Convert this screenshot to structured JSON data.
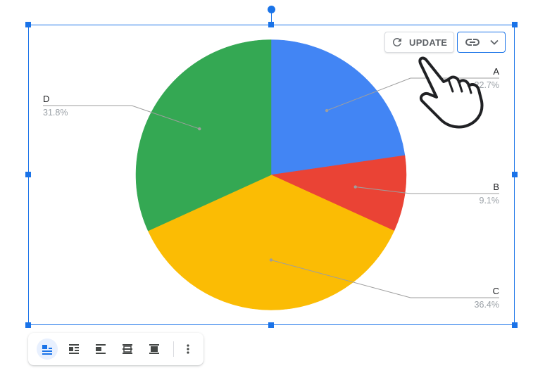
{
  "chart_data": {
    "type": "pie",
    "slices": [
      {
        "label": "A",
        "value": 22.7,
        "display": "22.7%",
        "color": "#4285f4"
      },
      {
        "label": "B",
        "value": 9.1,
        "display": "9.1%",
        "color": "#ea4335"
      },
      {
        "label": "C",
        "value": 36.4,
        "display": "36.4%",
        "color": "#fbbc04"
      },
      {
        "label": "D",
        "value": 31.8,
        "display": "31.8%",
        "color": "#34a853"
      }
    ],
    "start_angle_degrees": 0,
    "direction": "clockwise",
    "legend": "labeled leader lines"
  },
  "controls": {
    "update_label": "UPDATE",
    "update_icon": "refresh-icon",
    "link_icon": "link-icon",
    "link_dropdown_icon": "chevron-down-icon"
  },
  "toolbar": {
    "items": [
      {
        "name": "inline-text-button",
        "icon": "wrap-inline-icon",
        "active": true
      },
      {
        "name": "wrap-text-button",
        "icon": "wrap-text-icon",
        "active": false
      },
      {
        "name": "break-text-button",
        "icon": "break-text-icon",
        "active": false
      },
      {
        "name": "behind-text-button",
        "icon": "behind-text-icon",
        "active": false
      },
      {
        "name": "in-front-of-text-button",
        "icon": "in-front-of-text-icon",
        "active": false
      },
      {
        "name": "more-options-button",
        "icon": "more-vert-icon",
        "active": false
      }
    ]
  },
  "colors": {
    "selection": "#1a73e8",
    "label_text": "#202124",
    "percent_text": "#9aa0a6",
    "leader_line": "#9e9e9e"
  }
}
